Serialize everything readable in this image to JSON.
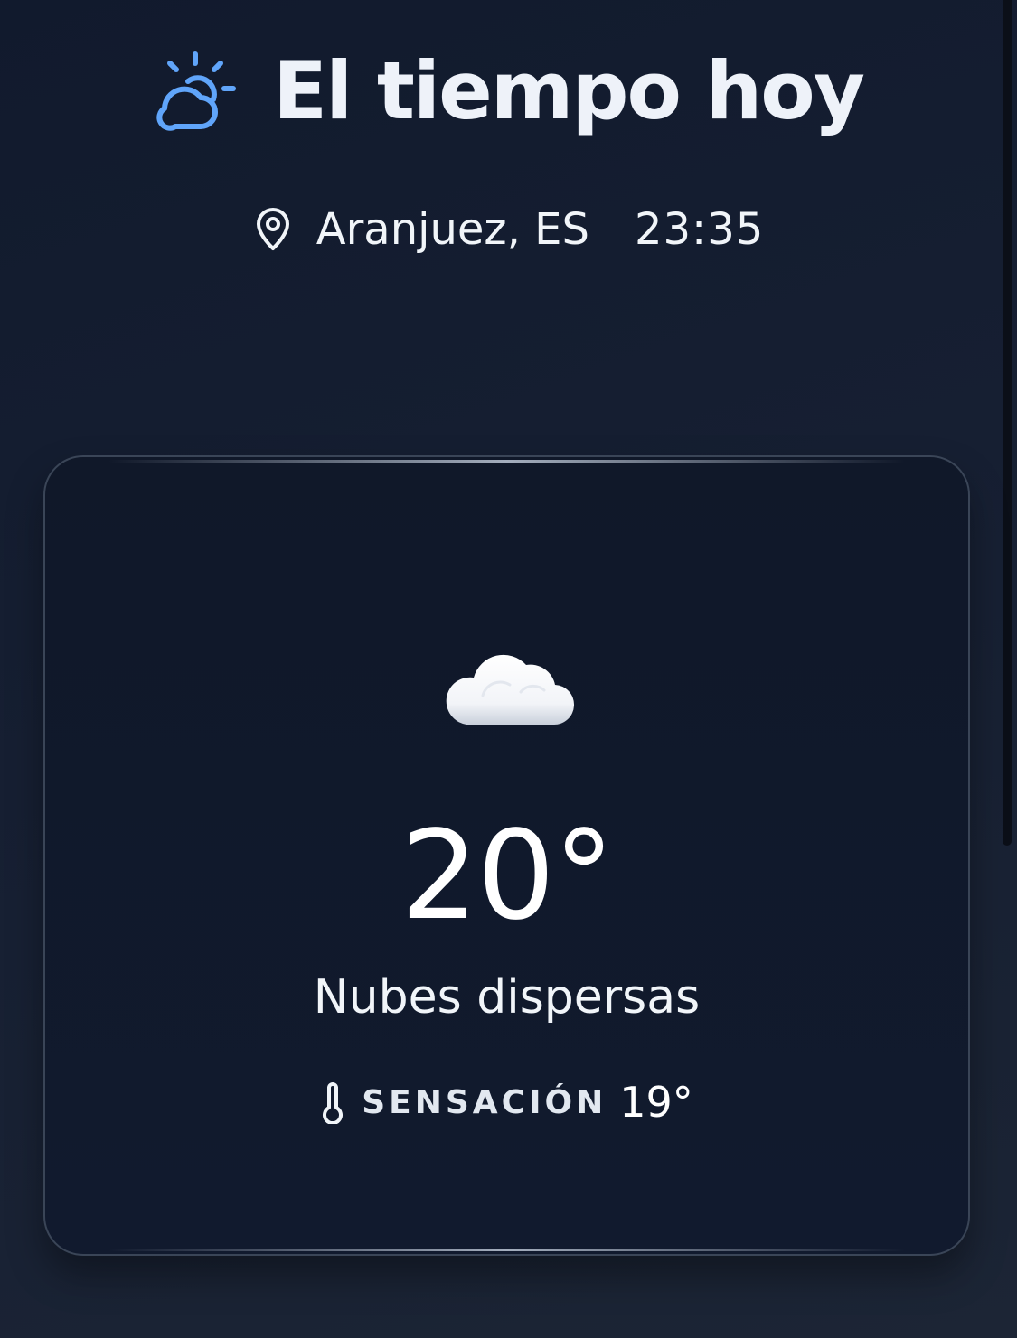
{
  "header": {
    "title": "El tiempo hoy",
    "icon": "partly-cloudy-sun-icon",
    "icon_color": "#60a5fa"
  },
  "location": {
    "icon": "map-pin-icon",
    "place": "Aranjuez, ES",
    "time": "23:35"
  },
  "current": {
    "condition_icon": "cloud-icon",
    "temperature": "20°",
    "description": "Nubes dispersas",
    "feels_like_icon": "thermometer-icon",
    "feels_like_label": "SENSACIÓN",
    "feels_like_value": "19°"
  },
  "colors": {
    "background": "#141d30",
    "card_background": "#101829",
    "card_border": "#3a4557",
    "accent": "#60a5fa",
    "text": "#f1f5f9"
  }
}
